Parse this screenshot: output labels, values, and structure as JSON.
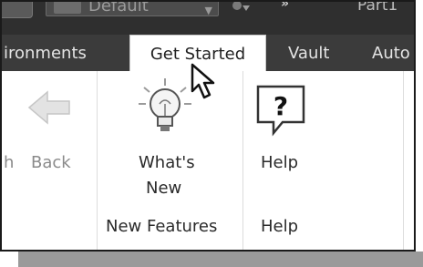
{
  "titlebar": {
    "view_dropdown": "Default",
    "document_title": "Part1"
  },
  "tabs": [
    {
      "label": "ironments"
    },
    {
      "label": "Get Started",
      "active": true
    },
    {
      "label": "Vault"
    },
    {
      "label": "Auto"
    }
  ],
  "ribbon": {
    "back": {
      "partial_left": "h",
      "label": "Back",
      "enabled": false
    },
    "whats_new": {
      "label_line1": "What's",
      "label_line2": "New"
    },
    "help_button": {
      "label": "Help"
    },
    "panels": {
      "new_features": "New Features",
      "help": "Help"
    }
  },
  "icons": [
    "back-arrow-icon",
    "lightbulb-icon",
    "help-question-icon",
    "mouse-cursor-icon",
    "filter-icon"
  ],
  "colors": {
    "titlebar_bg": "#2f2f2f",
    "tabbar_bg": "#3b3b3b",
    "ribbon_bg": "#ffffff"
  }
}
